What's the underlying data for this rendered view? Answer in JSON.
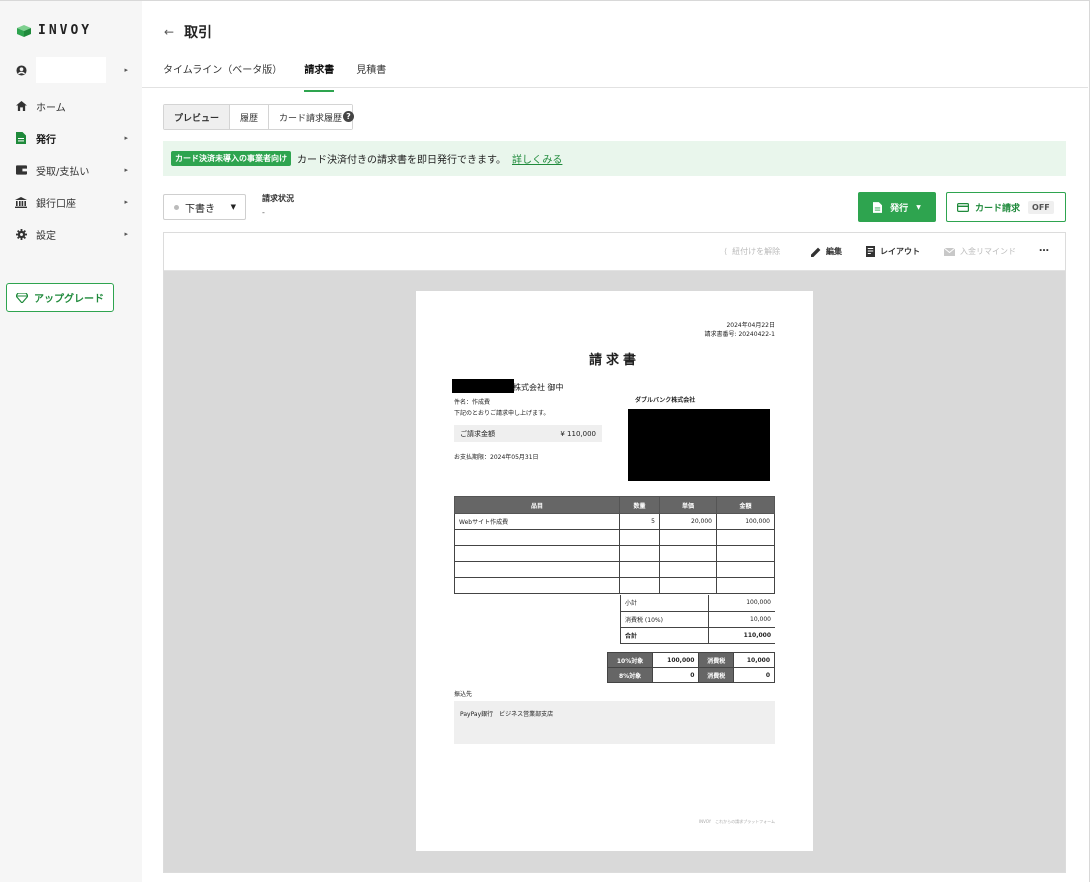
{
  "brand": {
    "name": "INVOY",
    "accent": "#2ea44f"
  },
  "sidebar": {
    "items": [
      {
        "label": "ホーム",
        "icon": "home-icon"
      },
      {
        "label": "発行",
        "icon": "document-icon"
      },
      {
        "label": "受取/支払い",
        "icon": "wallet-icon"
      },
      {
        "label": "銀行口座",
        "icon": "bank-icon"
      },
      {
        "label": "設定",
        "icon": "gear-icon"
      }
    ],
    "upgrade_label": "アップグレード"
  },
  "header": {
    "title": "取引",
    "back_icon": "back-arrow-icon"
  },
  "tabs": [
    {
      "label": "タイムライン（ベータ版）"
    },
    {
      "label": "請求書"
    },
    {
      "label": "見積書"
    }
  ],
  "subtabs": [
    {
      "label": "プレビュー"
    },
    {
      "label": "履歴"
    },
    {
      "label": "カード請求履歴"
    }
  ],
  "banner": {
    "badge": "カード決済未導入の事業者向け",
    "text": "カード決済付きの請求書を即日発行できます。",
    "link": "詳しくみる"
  },
  "status": {
    "value": "下書き",
    "request_label": "請求状況",
    "request_value": "-"
  },
  "actions": {
    "issue_label": "発行",
    "card_label": "カード請求",
    "card_state": "OFF"
  },
  "toolbar": {
    "unlink": "紐付けを解除",
    "edit": "編集",
    "layout": "レイアウト",
    "remind": "入金リマインド",
    "more": "…"
  },
  "invoice": {
    "date": "2024年04月22日",
    "number": "請求書番号: 20240422-1",
    "title": "請求書",
    "recipient_suffix": "株式会社 御中",
    "subject": "件名：作成費",
    "greeting": "下記のとおりご請求申し上げます。",
    "issuer": "ダブルバンク株式会社",
    "amount_label": "ご請求金額",
    "amount": "¥ 110,000",
    "due": "お支払期限：2024年05月31日",
    "headers": [
      "品目",
      "数量",
      "単価",
      "金額"
    ],
    "rows": [
      [
        "Webサイト作成費",
        "5",
        "20,000",
        "100,000"
      ],
      [
        "",
        "",
        "",
        ""
      ],
      [
        "",
        "",
        "",
        ""
      ],
      [
        "",
        "",
        "",
        ""
      ],
      [
        "",
        "",
        "",
        ""
      ]
    ],
    "subtotal_label": "小計",
    "subtotal": "100,000",
    "tax_label": "消費税 (10%)",
    "tax": "10,000",
    "total_label": "合計",
    "total": "110,000",
    "tax_rows": [
      [
        "10%対象",
        "100,000",
        "消費税",
        "10,000"
      ],
      [
        "8%対象",
        "0",
        "消費税",
        "0"
      ]
    ],
    "bank_label": "振込先",
    "bank": "PayPay銀行　ビジネス営業部支店",
    "footer": "INVOY　これからの請求プラットフォーム"
  }
}
